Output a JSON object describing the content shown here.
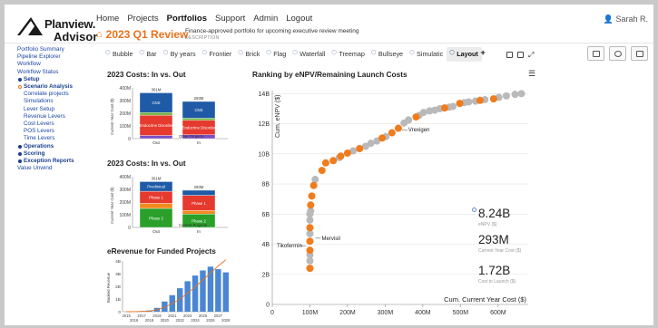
{
  "app": {
    "logo_line1": "Planview.",
    "logo_line2": "Advisor",
    "brand_color": "#e8721c",
    "user": "Sarah R."
  },
  "nav": {
    "items": [
      "Home",
      "Projects",
      "Portfolios",
      "Support",
      "Admin",
      "Logout"
    ],
    "active": "Portfolios"
  },
  "portfolio": {
    "name": "2023 Q1 Review",
    "description": "Finance-approved portfolio for upcoming executive review meeting",
    "description_label": "DESCRIPTION"
  },
  "sidebar": {
    "items": [
      {
        "label": "Portfolio Summary",
        "kind": "link"
      },
      {
        "label": "Pipeline Explorer",
        "kind": "link"
      },
      {
        "label": "Workflow",
        "kind": "link"
      },
      {
        "label": "Workflow Status",
        "kind": "link"
      },
      {
        "label": "Setup",
        "kind": "section"
      },
      {
        "label": "Scenario Analysis",
        "kind": "section-active"
      },
      {
        "label": "Correlate projects",
        "kind": "sub"
      },
      {
        "label": "Simulations",
        "kind": "sub"
      },
      {
        "label": "Lever Setup",
        "kind": "sub"
      },
      {
        "label": "Revenue Levers",
        "kind": "sub"
      },
      {
        "label": "Cost Levers",
        "kind": "sub"
      },
      {
        "label": "POS Levers",
        "kind": "sub"
      },
      {
        "label": "Time Levers",
        "kind": "sub"
      },
      {
        "label": "Operations",
        "kind": "section"
      },
      {
        "label": "Scoring",
        "kind": "section"
      },
      {
        "label": "Exception Reports",
        "kind": "section"
      },
      {
        "label": "Value Unwind",
        "kind": "link"
      }
    ]
  },
  "tabs": {
    "items": [
      "Bubble",
      "Bar",
      "By years",
      "Frontier",
      "Brick",
      "Flag",
      "Waterfall",
      "Treemap",
      "Bullseye",
      "Simulatic",
      "Layout"
    ],
    "active": "Layout",
    "add_label": "+"
  },
  "chart_data": [
    {
      "type": "bar",
      "title": "2023 Costs: In vs. Out",
      "ylabel": "Current Year Cost ($)",
      "yticks": [
        "0",
        "100M",
        "200M",
        "300M",
        "400M"
      ],
      "ylim": [
        0,
        400
      ],
      "categories": [
        "Out",
        "In"
      ],
      "totals": [
        "361M",
        "293M"
      ],
      "series": [
        {
          "name": "Immunology",
          "values": [
            25,
            30
          ],
          "color": "#7b4fc4"
        },
        {
          "name": "Endocrine Disorder",
          "values": [
            160,
            115
          ],
          "color": "#e63a2e"
        },
        {
          "name": "Oncology",
          "values": [
            20,
            16
          ],
          "color": "#6fb23a"
        },
        {
          "name": "CNS",
          "values": [
            156,
            132
          ],
          "color": "#1f5aa6"
        }
      ],
      "annotations": [
        "Out",
        "In",
        "Other",
        "Projects"
      ]
    },
    {
      "type": "bar",
      "title": "2023 Costs: In vs. Out",
      "ylabel": "Current Year Cost ($)",
      "yticks": [
        "0",
        "100M",
        "200M",
        "300M",
        "400M"
      ],
      "ylim": [
        0,
        400
      ],
      "categories": [
        "Out",
        "In"
      ],
      "totals": [
        "361M",
        "293M"
      ],
      "series": [
        {
          "name": "Phase 2",
          "values": [
            150,
            105
          ],
          "color": "#2aa02a"
        },
        {
          "name": "Phase 3",
          "values": [
            40,
            28
          ],
          "color": "#f28b1f"
        },
        {
          "name": "Phase 1",
          "values": [
            95,
            120
          ],
          "color": "#e63a2e"
        },
        {
          "name": "Preclinical",
          "values": [
            76,
            40
          ],
          "color": "#1f5aa6"
        }
      ],
      "annotations": [
        "Current",
        "Projects"
      ]
    },
    {
      "type": "bar",
      "title": "eRevenue for Funded Projects",
      "ylabel": "Booked Revenue",
      "yticks": [
        "0",
        "1B",
        "2B",
        "3B",
        "4B"
      ],
      "ylim": [
        0,
        4
      ],
      "categories": [
        "2015",
        "2016",
        "2017",
        "2018",
        "2019",
        "2020",
        "2021",
        "2022",
        "2023",
        "2024",
        "2025",
        "2026",
        "2027",
        "2028"
      ],
      "values": [
        0.0,
        0.02,
        0.05,
        0.1,
        0.3,
        0.8,
        1.3,
        1.85,
        2.4,
        2.85,
        3.25,
        3.55,
        3.35,
        3.1
      ],
      "trend": [
        0.0,
        0.01,
        0.02,
        0.05,
        0.15,
        0.35,
        0.65,
        1.0,
        1.45,
        1.95,
        2.5,
        3.05,
        3.6,
        4.1
      ],
      "bar_color": "#4a86d4",
      "trend_color": "#e8721c"
    },
    {
      "type": "scatter",
      "title": "Ranking by eNPV/Remaining Launch Costs",
      "xlabel": "Cum. Current Year Cost ($)",
      "ylabel": "Cum. eNPV ($)",
      "xticks": [
        "0",
        "100M",
        "200M",
        "300M",
        "400M",
        "500M",
        "600M"
      ],
      "yticks": [
        "0",
        "2B",
        "4B",
        "6B",
        "8B",
        "10B",
        "12B",
        "14B"
      ],
      "xlim": [
        0,
        680
      ],
      "ylim": [
        0,
        14.2
      ],
      "grid": true,
      "point_labels": [
        {
          "text": "Vrexigen",
          "x": 335,
          "y": 11.6
        },
        {
          "text": "Mervisil",
          "x": 105,
          "y": 4.4
        },
        {
          "text": "Tikofermin",
          "x": 100,
          "y": 3.9
        }
      ],
      "series": [
        {
          "kind": "funded",
          "color": "#f07c1c",
          "points": [
            [
              100,
              2.4
            ],
            [
              100,
              3.6
            ],
            [
              100,
              4.2
            ],
            [
              100,
              5.1
            ],
            [
              102,
              6.6
            ],
            [
              105,
              7.2
            ],
            [
              110,
              7.9
            ],
            [
              132,
              8.9
            ],
            [
              142,
              9.4
            ],
            [
              162,
              9.55
            ],
            [
              182,
              9.85
            ],
            [
              200,
              10.05
            ],
            [
              232,
              10.35
            ],
            [
              292,
              11.05
            ],
            [
              318,
              11.4
            ],
            [
              335,
              11.7
            ],
            [
              382,
              12.45
            ],
            [
              458,
              13.05
            ],
            [
              498,
              13.35
            ],
            [
              552,
              13.55
            ],
            [
              588,
              13.65
            ]
          ]
        },
        {
          "kind": "unfunded",
          "color": "#b9b9b9",
          "points": [
            [
              100,
              2.9
            ],
            [
              100,
              3.3
            ],
            [
              100,
              4.7
            ],
            [
              100,
              5.6
            ],
            [
              100,
              6.0
            ],
            [
              102,
              6.2
            ],
            [
              114,
              8.3
            ],
            [
              178,
              9.75
            ],
            [
              215,
              10.2
            ],
            [
              248,
              10.5
            ],
            [
              262,
              10.7
            ],
            [
              278,
              10.85
            ],
            [
              302,
              11.15
            ],
            [
              350,
              12.05
            ],
            [
              362,
              12.25
            ],
            [
              390,
              12.55
            ],
            [
              402,
              12.75
            ],
            [
              418,
              12.85
            ],
            [
              432,
              12.9
            ],
            [
              445,
              13.0
            ],
            [
              470,
              13.1
            ],
            [
              480,
              13.15
            ],
            [
              510,
              13.4
            ],
            [
              522,
              13.45
            ],
            [
              540,
              13.5
            ],
            [
              565,
              13.6
            ],
            [
              602,
              13.75
            ],
            [
              622,
              13.85
            ],
            [
              645,
              13.95
            ],
            [
              662,
              14.0
            ]
          ]
        }
      ]
    }
  ],
  "metrics": [
    {
      "value": "8.24B",
      "label": "eNPV ($)"
    },
    {
      "value": "293M",
      "label": "Current Year Cost ($)"
    },
    {
      "value": "1.72B",
      "label": "Cost to Launch ($)"
    }
  ],
  "menu_icon": "hamburger-icon"
}
